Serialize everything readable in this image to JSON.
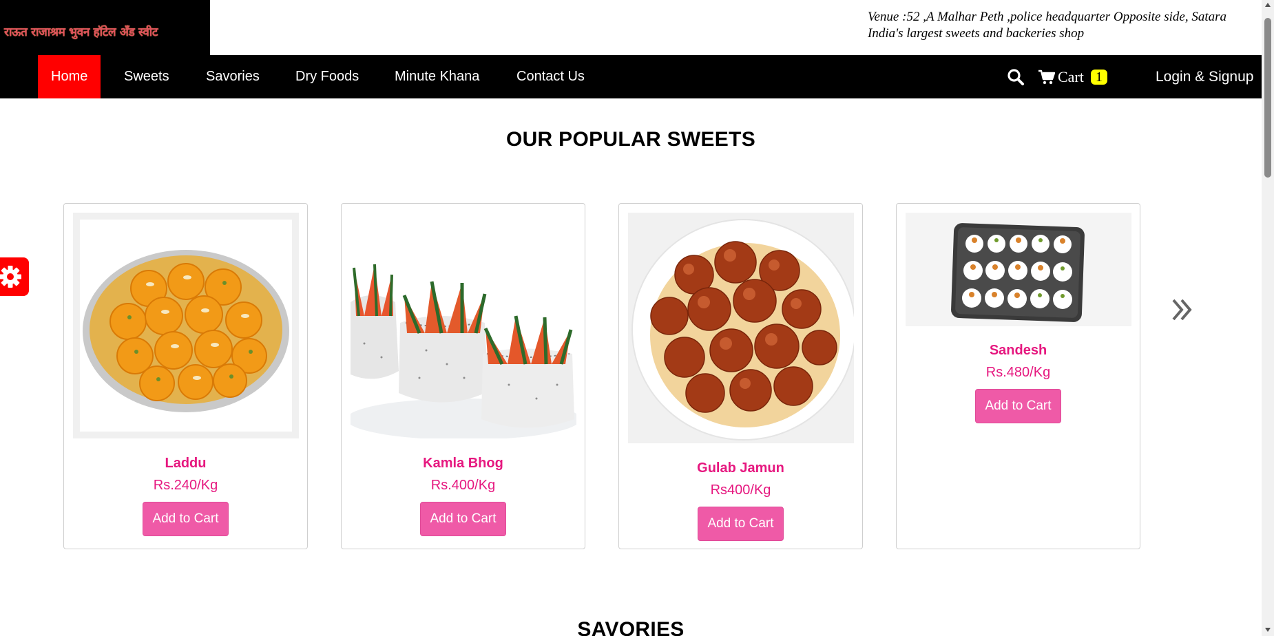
{
  "header": {
    "logo_text": "राऊत राजाश्रम भुवन हॉटेल अँड स्वीट",
    "venue_line1": "Venue :52 ,A Malhar Peth ,police headquarter Opposite side, Satara",
    "venue_line2": "India's largest sweets and backeries shop"
  },
  "nav": {
    "items": [
      {
        "label": "Home",
        "active": true
      },
      {
        "label": "Sweets"
      },
      {
        "label": "Savories"
      },
      {
        "label": "Dry Foods"
      },
      {
        "label": "Minute Khana"
      },
      {
        "label": "Contact Us"
      }
    ],
    "search_icon": "search-icon",
    "cart_label": "Cart",
    "cart_count": "1",
    "login_label": "Login & Signup"
  },
  "popular": {
    "title": "OUR POPULAR SWEETS",
    "products": [
      {
        "name": "Laddu",
        "price": "Rs.240/Kg",
        "button": "Add to Cart"
      },
      {
        "name": "Kamla Bhog",
        "price": "Rs.400/Kg",
        "button": "Add to Cart"
      },
      {
        "name": "Gulab Jamun",
        "price": "Rs400/Kg",
        "button": "Add to Cart"
      },
      {
        "name": "Sandesh",
        "price": "Rs.480/Kg",
        "button": "Add to Cart"
      }
    ]
  },
  "savories": {
    "title": "SAVORIES"
  },
  "colors": {
    "nav_bg": "#000000",
    "active_tab": "#ff0000",
    "product_text": "#e6177f",
    "button_bg": "#ef5aa7",
    "cart_badge": "#ffff00",
    "settings_tab": "#ff0000"
  }
}
